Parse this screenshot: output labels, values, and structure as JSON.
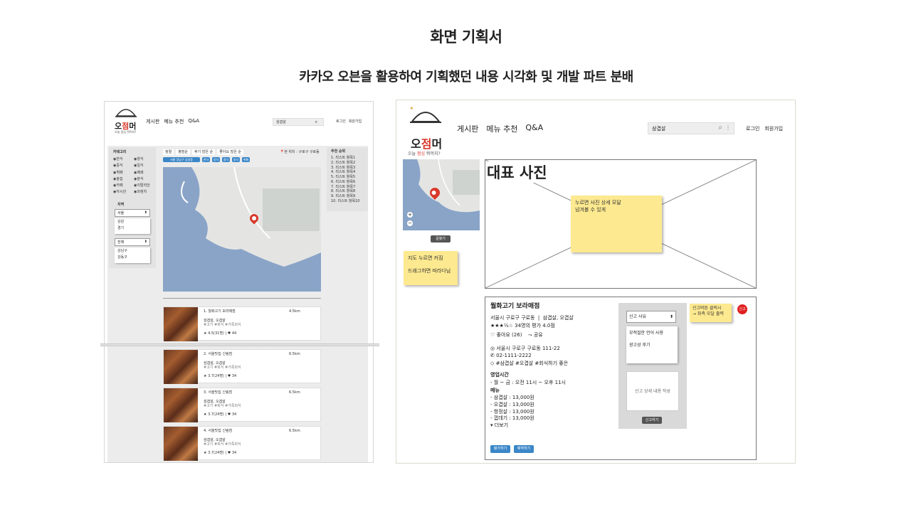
{
  "slide": {
    "title": "화면 기획서",
    "subtitle": "카카오 오븐을 활용하여 기획했던 내용 시각화 및 개발 파트 분배"
  },
  "left": {
    "logo_main": "오",
    "logo_red": "점",
    "logo_end": "머",
    "tagline": "오늘 점심 뭐먹지?",
    "nav": [
      "게시판",
      "메뉴 추천",
      "Q&A"
    ],
    "search_value": "삼겹살",
    "login": "로그인",
    "signup": "회원가입",
    "category_title": "카테고리",
    "categories": [
      "한식",
      "양식",
      "중식",
      "일식",
      "뷔페",
      "패쇄",
      "술집",
      "분식",
      "카페",
      "이탈리안",
      "아시안",
      "프렌치"
    ],
    "region_title": "지역",
    "region_select": "서울",
    "region_options": [
      "강원",
      "경기"
    ],
    "district_select": "전체",
    "district_options": [
      "강남구",
      "강동구"
    ],
    "filters": [
      "정렬",
      "평점순",
      "후기 많은 순",
      "좋아요 많은 순"
    ],
    "location_text": "현 위치 : 구로구 구로동",
    "chip_wide": "서울 강남구 삼성동",
    "chips": [
      "한식",
      "양식",
      "중식",
      "일식",
      "뷔페"
    ],
    "ranking_title": "추천 순위",
    "ranking": [
      "1. 리스트 항목1",
      "2. 리스트 항목2",
      "3. 리스트 항목3",
      "4. 리스트 항목4",
      "5. 리스트 항목5",
      "6. 리스트 항목6",
      "7. 리스트 항목7",
      "8. 리스트 항목8",
      "9. 리스트 항목9",
      "10. 리스트 항목10"
    ],
    "results": [
      {
        "name": "1. 월화고기 보라매점",
        "dist": "4.5km",
        "menu": "삼겹살, 오겹살",
        "tags": "#고기 #회식 #가족외식",
        "rating": "★ 4.5(31명) | ♥ 44"
      },
      {
        "name": "2. 서울맛집 신림점",
        "dist": "6.5km",
        "menu": "삼겹살, 오겹살",
        "tags": "#고기 #회식 #가족외식",
        "rating": "★ 3.7(24명) | ♥ 34"
      },
      {
        "name": "3. 서울맛집 신림점",
        "dist": "6.5km",
        "menu": "삼겹살, 오겹살",
        "tags": "#고기 #회식 #가족외식",
        "rating": "★ 3.7(24명) | ♥ 34"
      },
      {
        "name": "4. 서울맛집 신림점",
        "dist": "6.5km",
        "menu": "삼겹살, 오겹살",
        "tags": "#고기 #회식 #가족외식",
        "rating": "★ 3.7(24명) | ♥ 34"
      }
    ]
  },
  "right": {
    "logo_main": "오",
    "logo_red": "점",
    "logo_end": "머",
    "tagline_pre": "오늘 ",
    "tagline_red": "점심",
    "tagline_post": " 뭐먹지?",
    "nav": [
      "게시판",
      "메뉴 추천",
      "Q&A"
    ],
    "search_value": "삼겹살",
    "login": "로그인",
    "signup": "회원가입",
    "directions": "길찾기",
    "sticky_map": [
      "지도 누르면 커짐",
      "드래그하면 따라다님"
    ],
    "hero_label": "대표 사진",
    "sticky_hero": [
      "누르면 사진 상세 모달",
      "넘겨볼 수 있게"
    ],
    "store_name": "월화고기 보라매점",
    "store_meta": "서울시 구로구 구로동  |  삼겹살, 오겹살",
    "store_rating": "34명의 평가 4.0점",
    "like": "좋아요 (26)",
    "share": "공유",
    "address": "서울시 구로구 구로동 111-22",
    "phone": "02-1111-2222",
    "tags": "#삼겹살 #오겹살 #회식하기 좋은",
    "hours_title": "영업시간",
    "hours": "- 월 ~ 금 : 오전 11시 ~ 오후 11시",
    "menu_title": "메뉴",
    "menu": [
      "- 삼겹살 : 13,000원",
      "- 오겹살 : 13,000원",
      "- 항정살 : 13,000원",
      "- 껍데기 : 13,000원"
    ],
    "more": "▾ 더보기",
    "btn_review": "평가하기",
    "btn_reserve": "예약하기",
    "report_select": "신고 사유",
    "report_options": [
      "부적절한 언어 사용",
      "광고성 후기"
    ],
    "report_placeholder": "신고 상세 내용 작성",
    "report_submit": "신고하기",
    "sticky_report": [
      "신고버튼 클릭시",
      "→ 좌측 모달 출력"
    ],
    "report_badge": "신고"
  },
  "colors": {
    "accent": "#d9382a",
    "link": "#3a86c8",
    "sticky": "#fde98f",
    "water": "#8aa4c8"
  }
}
